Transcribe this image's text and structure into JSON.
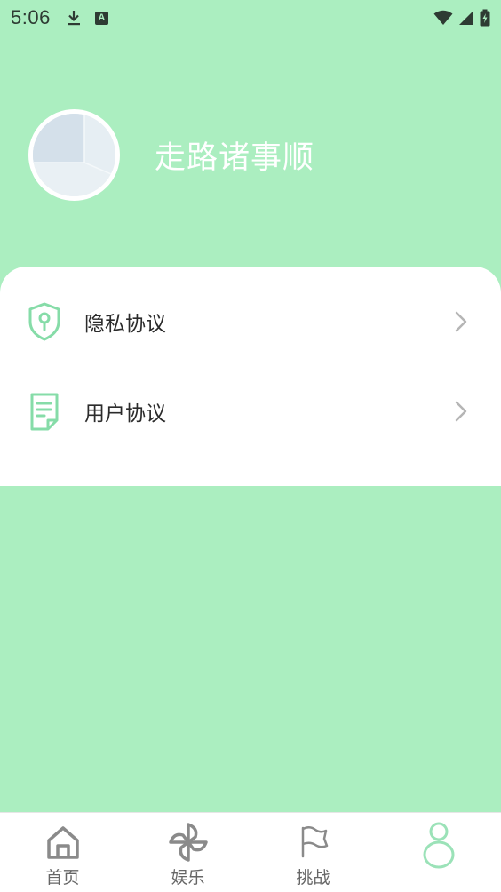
{
  "status_bar": {
    "time": "5:06",
    "keyboard_badge": "A"
  },
  "profile": {
    "username": "走路诸事顺"
  },
  "menu": {
    "items": [
      {
        "label": "隐私协议",
        "icon": "shield-keyhole-icon"
      },
      {
        "label": "用户协议",
        "icon": "document-icon"
      }
    ]
  },
  "tabbar": {
    "tabs": [
      {
        "label": "首页",
        "icon": "home-icon",
        "active": false
      },
      {
        "label": "娱乐",
        "icon": "pinwheel-icon",
        "active": false
      },
      {
        "label": "挑战",
        "icon": "flag-icon",
        "active": false
      },
      {
        "label": "",
        "icon": "person-outline-icon",
        "active": true
      }
    ]
  },
  "colors": {
    "background": "#abeec0",
    "accent": "#7ed8a2",
    "card": "#ffffff"
  }
}
